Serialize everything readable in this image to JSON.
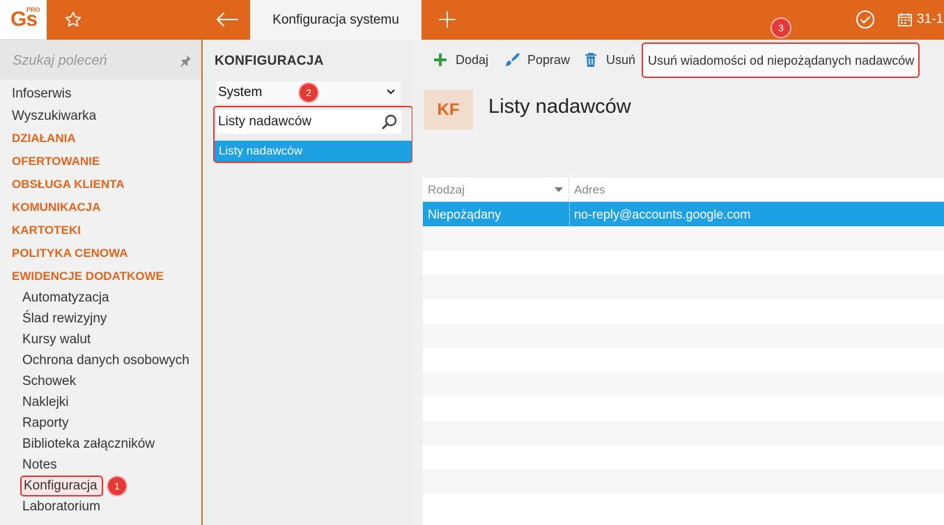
{
  "app": {
    "logo_text": "Gs",
    "logo_sup": "PRO",
    "active_tab": "Konfiguracja systemu",
    "date_label": "31-1"
  },
  "sidebar": {
    "search_placeholder": "Szukaj poleceń",
    "top_items": [
      "Infoserwis",
      "Wyszukiwarka"
    ],
    "sections": [
      "DZIAŁANIA",
      "OFERTOWANIE",
      "OBSŁUGA KLIENTA",
      "KOMUNIKACJA",
      "KARTOTEKI",
      "POLITYKA CENOWA",
      "EWIDENCJE DODATKOWE"
    ],
    "sub_items": [
      "Automatyzacja",
      "Ślad rewizyjny",
      "Kursy walut",
      "Ochrona danych osobowych",
      "Schowek",
      "Naklejki",
      "Raporty",
      "Biblioteka załączników",
      "Notes",
      "Konfiguracja",
      "Laboratorium"
    ]
  },
  "middle": {
    "title": "KONFIGURACJA",
    "select_value": "System",
    "filter_value": "Listy nadawców",
    "result_item": "Listy nadawców"
  },
  "toolbar": {
    "add": "Dodaj",
    "edit": "Popraw",
    "delete": "Usuń",
    "remove_spam": "Usuń wiadomości od niepożądanych nadawców"
  },
  "main": {
    "badge": "KF",
    "heading": "Listy nadawców",
    "columns": [
      "Rodzaj",
      "Adres"
    ],
    "rows": [
      {
        "rodzaj": "Niepożądany",
        "adres": "no-reply@accounts.google.com"
      }
    ]
  },
  "callouts": [
    "1",
    "2",
    "3"
  ],
  "colors": {
    "accent": "#e0661c",
    "selection": "#1da1e2",
    "callout": "#e53935"
  }
}
